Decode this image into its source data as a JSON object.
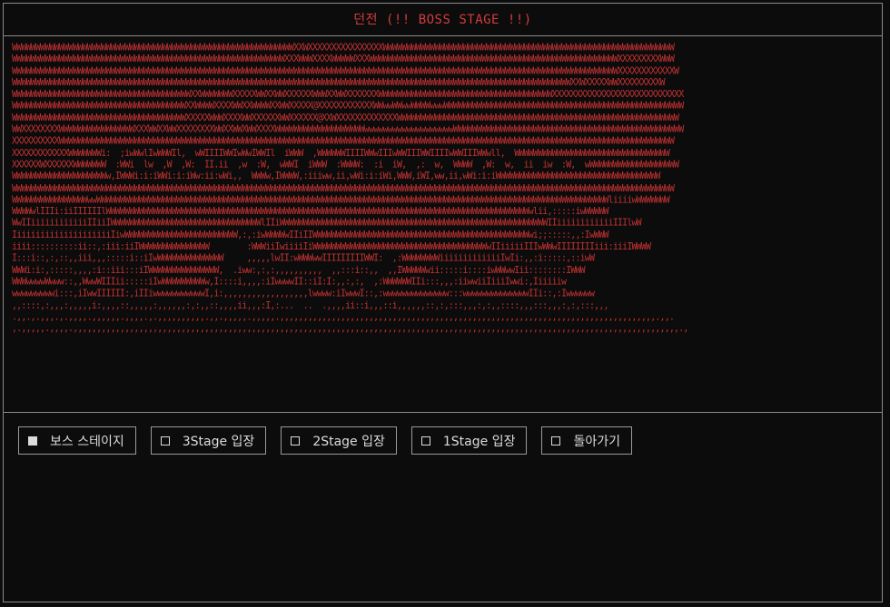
{
  "title": "던전 (!! BOSS STAGE !!)",
  "colors": {
    "art": "#c23232",
    "title": "#d23c3c",
    "text": "#dcdcdc",
    "bg": "#0c0c0c"
  },
  "ascii_art": [
    "WWWWWWWWWWWWWWWWWWWWWWWWWWWWWWWWWWWWWWWWWWWWWWWWWWWWWWWWWWWWXXWXXXXXXXXXXXXXXXXWWWWWWWWWWWWWWWWWWWWWWWWWWWWWWWWWWWWWWWWWWWWWWWWWWWWWWWWWWWWWW",
    "WWWWWWWWWWWWWWWWWWWWWWWWWWWWWWWWWWWWWWWWWWWWWWWWWWWWWWWWWWXXXWWWXXXXWWWWWXXXWWWWWWWWWWWWWWWWWWWWWWWWWWWWWWWWWWWWWWWWWWWWWWWWWWWWWXXXXXXXXXWWW",
    "WWWWWWWWWWWWWWWWWWWWWWWWWWWWWWWWWWWWWWWWWWWWWWWWWWWWWWWWWWWWWWWWWWWWWWWWWWWWWWWWWWWWWWWWWWWWWWWWWWWWWWWWWWWWWWWWWWWWWWWWWWWWWWWWWXXXXXXXXXXXXW",
    "WWWWWWWWWWWWWWWWWWWWWWWWWWWWWWWWWWWWWWWWWWWWWWWWWWWWWWWWWWWWWWWWWWWWWWWWWWWWWWWWWWWWWWWWWWWWWWWWWWWWWWWWWWWWWWWWWWWWWWWXXWXXXXXWWXXXXXXXXXW",
    "WWWWWWWWWWWWWWWWWWWWWWWWWWWWWWWWWWWWWWXXWWWWWWWXXXXXWWXXWWXXXXXXWWWXXWWXXXXXXXWWWWWWWWWWWWWWWWWWWWWWWWWWWWWWWWWWWWWXXXXXXXXXXXXXXXXXXXXXXXXXXXX",
    "WWWWWWWWWWWWWWWWWWWWWWWWWWWWWWWWWWWWWXXWWWWXXXXWWXXWWWWXXWWXXXXX@XXXXXXXXXXXXWWwwWWwwWWWWwwwWWWWWWWWWWWWWWWWWWWWWWWWWWWWWWWWWWWWWWWWWWWWWWWWWWW",
    "WWWWWWWWWWWWWWWWWWWWWWWWWWWWWWWWWWWWWXXXXXWWWXXXXWWXXXXXXWWXXXXXX@XXWXXXXXXXXXXXXXWWWWWWWWWWWWWWWWWWWWWWWWWWWWWWWWWWWWWWWWWWWWWWWWWWWWWWWWWWWW",
    "WWXXXXXXXXWWWWWWWWWWWWWWWWXXXWWXXWWXXXXXXXXWWXXWWXWWXXXXWWWWWWWWWWWWWWWWWWWwwwwwwwwwwwwwwwwwwwWWWWWWWWWWWWWWWWWWWWWWWWWWWWWWWWWWWWWWWWWWWWWWWWW",
    "XXXXXXXXXXWWWWWWWWWWWWWWWWWWWWWWWWWWWWWWWWWWWWWWWWWWWWWWWWWWWWWWWWWWWWWWWWWWWWWWWWWWWWWWWWWWWWWWWWWWWWWWWWWWWWWWWWWWWWWWWWWWWWWWWWWWWWWWWWWWW",
    "XXXXXXXXXXXXWWWWWWWi:  ;iwWwlIwWWWIl,  wWIIIIWWIwWwIWWIl  iWWW  ,WWWWWWIIIIWWwIIIwWWIIIWWIIIIwWWIIIWWwll,  WWWWWWWWWWWWWWWWWWWWWWWWWWWWWWWWW",
    "XXXXXXWXXXXXXWWWWWWW  :WWi  lw  ,W  ,W:  II.ii  ,w  :W,  wWWI  iWWW  :WWWW:  :i  iW,  ,:  w,  WWWW  ,W:  w,  ii  iw  :W,  wWWWWWWWWWWWWWWWWWWW",
    "WWWWWWWWWWWWWWWWWWWWw,IWWWi:i:iWWi:i:iWw:ii:wWi,,  WWWw,IWWWW,:iiiww,ii,wWi:i:iWi,WWW,iWI,ww,ii,wWi:i:iWWWWWWWWWWWWWWWWWWWWWWWWWWWWWWWWWWW",
    "WWWWWWWWWWWWWWWWWWWWWWWWWWWWWWWWWWWWWWWWWWWWWWWWWWWWWWWWWWWWWWWWWWWWWWWWWWWWWWWWWWWWWWWWWWWWWWWWWWWWWWWWWWWWWWWWWWWWWWWWWWWWWWWWWWWWWWWWWWWWW",
    "WWWWWWWWWWWWWWWWwwWWWWWWWWWWWWWWWWWWWWWWWWWWWWWWWWWWWWWWWWWWWWWWWWWWWWWWWWWWWWWWWWWWWWWWWWWWWWWWWWWWWWWWWWWWWWWWWWWWWWWWWWWWWWWliiiiwWWWWWWW",
    "WWWWwlIIIi:iiIIIIIIlWWWWWWWWWWWWWWWWWWWWWWWWWWWWWWWWWWWWWWWWWWWWWWWWWWWWWWWWWWWWWWWWWWWWWWWWWWWWWWWWWWWWWWWWWWwlii,:::::iwWWWWW",
    "WwIIiiiiiiiiiiiiIIiiIWWWWWWWWWWWWWWWWWWWWWWWWWWWWWWWWlIIiWWWWWWWWWWWWWWWWWWWWWWWWWWWWWWWWWWWWWWWWWWWWWWWWWWWWWWWWWIIiiiiiiiiiiiiIIIlwW",
    "IiiiiiiiiiiiiiiiiiiiiIiwWWWWWWWWWWWWWWWWWWWWWWWW,:,:iwWWWWwIIiIIWWWWWWWWWWWWWWWWWWWWWWWWWWWWWWWWWWWWWWWWWWWWWWwi;;:::::,,:IwWWW",
    "iiii::::::::::ii::,:iii:iiIWWWWWWWWWWWWWWW        :WWWiiIwiiiiIiWWWWWWWWWWWWWWWWWWWWWWWWWWWWWWWWWWWWWwIIiiiiiIIIwWWwIIIIIIIIiii:iiiIWWWW",
    "I:::i::,:,::,,iii,,,:::::i::iIwWWWWWWWWWWWWWW     ,,,,,lwII:wWWWwwIIIIIIIIIWWI:  ,:WWWWWWWWiiiiiiiiiiiiiIwIi:,,:i:::::,::iwW",
    "WWWi:i:,:::::,,,,:i::iii:::iIWWWWWWWWWWWWWWW,  .iww:,:,:,,,,,,,,,,  ,,:::i::,,  ,,IWWWWWwii:::::i::::iwWWwwIii::::::::IWWW",
    "WWWwwwwWwww::,,WwwWIIIii:::::iIwWWWWWWWWWw,I::::i,,,,:iIwwwwII::iI:I:,,:,:,  ,:WWWWWWIIi:::,,,:iiwwiiIiiiIwwi:,Iiiiiiw",
    "wwwwwwwwwi:::,iIwwIIIIII:,iIIiwwwwwwwwwwwI,i:,,,,,,,,,,,,,,,,,,lwwww:iIwwwI::,:wwwwwwwwwwwwww:::wwwwwwwwwwwwwwIIi::,:Iwwwwww",
    ",,::::,:,,,:,,,,,i:,,,,::,,,,,:,,,,,,:,:,,::,,,,ii,,,:I,:...  ..  .,,,,ii::i,,,::i,,,,,,::,:,:::,,,:,:,,::::,,,:::,,,:,:,:::,,,",
    ".,,.,.,,,.,.,,,,.,,,,,,.,,,,.,.,,,,,,,,,,.,,.,,,,,.,,,,,.,,,,,,,,,,,,,,,,,,,,,,,,,,,,,,,,,,,,,,,,,,,,,,,,,,,,,,,,,,,,,,,,,,,,,,,,,,,,,,,,.,,.",
    ",.,,,,,.,,,,.,,,,,,,,,,,,,,,,,,,,,,,,,,,,,,,,,,,,,,,,,,,,,,,,,,,,,,,,,,,,,,,,,,,,,,,,,,,,,,,,,,,,,,,,,,,,,,,,,,,,,,,,,,,,,,,,,,,,,,,,,,,,,,,,,.,"
  ],
  "menu": [
    {
      "label": "보스 스테이지",
      "selected": true
    },
    {
      "label": "3Stage 입장",
      "selected": false
    },
    {
      "label": "2Stage 입장",
      "selected": false
    },
    {
      "label": "1Stage 입장",
      "selected": false
    },
    {
      "label": "돌아가기",
      "selected": false
    }
  ]
}
